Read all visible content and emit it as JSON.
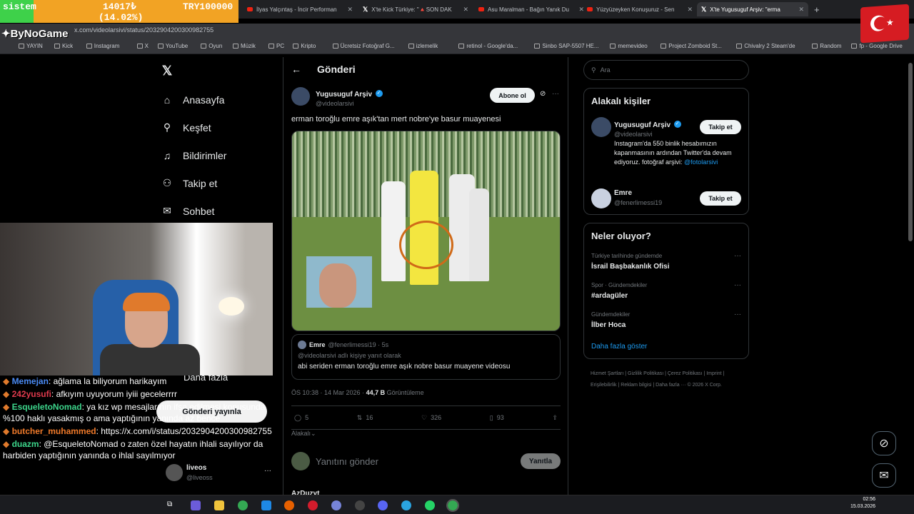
{
  "browser": {
    "tabs": [
      {
        "label": "İlyas Yalçıntaş - İncir Performan",
        "type": "youtube"
      },
      {
        "label": "X'te Kick Türkiye: \"🔺SON DAK",
        "type": "x"
      },
      {
        "label": "Asu Maralman - Bağın Yanık Du",
        "type": "youtube"
      },
      {
        "label": "Yüzyüzeyken Konuşuruz - Sen",
        "type": "youtube"
      },
      {
        "label": "X'te Yugusuguf Arşiv: \"erma",
        "type": "x"
      }
    ],
    "url": "x.com/videolarsivi/status/2032904200300982755",
    "bookmarks": [
      "YAYIN",
      "Kick",
      "Instagram",
      "X",
      "YouTube",
      "Oyun",
      "Müzik",
      "PC",
      "Kripto",
      "Ücretsiz Fotoğraf G...",
      "izlemelik",
      "retinol - Google'da...",
      "Sinbo SAP-5507 HE...",
      "memevideo",
      "Project Zomboid St...",
      "Chivalry 2 Steam'de",
      "Random",
      "fp - Google Drive"
    ]
  },
  "stream_overlay": {
    "goal_label": "sistem",
    "goal_value": "14017₺",
    "goal_pct": "(14.02%)",
    "goal_target": "TRY100000",
    "goal_fraction": 0.1402,
    "channel": "ByNoGame"
  },
  "nav": {
    "items": [
      {
        "label": "Anasayfa",
        "icon": "home-icon"
      },
      {
        "label": "Keşfet",
        "icon": "search-icon"
      },
      {
        "label": "Bildirimler",
        "icon": "bell-icon"
      },
      {
        "label": "Takip et",
        "icon": "add-person-icon"
      },
      {
        "label": "Sohbet",
        "icon": "mail-icon"
      }
    ],
    "more": "Daha fazla"
  },
  "chat": [
    {
      "user": "Memejan",
      "color": "#4a8bf5",
      "msg": ": ağlama la biliyorum harikayım"
    },
    {
      "user": "242yusufi",
      "color": "#e03a4d",
      "msg": ": afkıyım uyuyorum iyiii gecelerrrr"
    },
    {
      "user": "EsqueletoNomad",
      "color": "#3dd68c",
      "msg": ": ya kız wp mesajlarının ifşa edilmesi konusunda %100 haklı yasakmış o ama yaptığının yanında az bence"
    },
    {
      "user": "butcher_muhammed",
      "color": "#f07a2a",
      "msg": ": https://x.com/i/status/2032904200300982755"
    },
    {
      "user": "duazm",
      "color": "#3dd68c",
      "msg": ": @EsqueletoNomad o zaten özel hayatın ihlali sayılıyor da harbiden yaptığının yanında o ihlal sayılmıyor"
    }
  ],
  "post": {
    "header": "Gönderi",
    "author_name": "Yugusuguf Arşiv",
    "author_handle": "@videolarsivi",
    "subscribe": "Abone ol",
    "text": "erman toroğlu emre aşık'tan mert nobre'ye basur muayenesi",
    "quote": {
      "name": "Emre",
      "handle": "@fenerlimessi19 · 5s",
      "reply_to": "@videolarsivi adlı kişiye yanıt olarak",
      "text": "abi seriden erman toroğlu emre aşık nobre basur muayene videosu"
    },
    "time": "ÖS 10:38 · 14 Mar 2026 · ",
    "views": "44,7 B",
    "views_label": " Görüntüleme",
    "stats": {
      "replies": "5",
      "reposts": "16",
      "likes": "326",
      "bookmarks": "93"
    },
    "relevance": "Alakalı",
    "reply_placeholder": "Yanıtını gönder",
    "reply_button": "Yanıtla",
    "post_overlay_button": "Gönderi yayınla",
    "next_author": "AzDuzyt",
    "liveos_name": "liveos",
    "liveos_handle": "@liveoss"
  },
  "sidebar": {
    "search_placeholder": "Ara",
    "related_title": "Alakalı kişiler",
    "people": [
      {
        "name": "Yugusuguf Arşiv",
        "handle": "@videolarsivi",
        "bio": "Instagram'da 550 binlik hesabımızın kapanmasının ardından Twitter'da devam ediyoruz. fotoğraf arşivi: ",
        "bio_link": "@fotolarsivi",
        "follow": "Takip et"
      },
      {
        "name": "Emre",
        "handle": "@fenerlimessi19",
        "follow": "Takip et"
      }
    ],
    "trends_title": "Neler oluyor?",
    "trends": [
      {
        "category": "Türkiye tarihinde gündemde",
        "title": "İsrail Başbakanlık Ofisi"
      },
      {
        "category": "Spor · Gündemdekiler",
        "title": "#ardagüler"
      },
      {
        "category": "Gündemdekiler",
        "title": "İlber Hoca"
      }
    ],
    "show_more": "Daha fazla göster",
    "footer": "Hizmet Şartları | Gizlilik Politikası | Çerez Politikası | Imprint | Erişilebilirlik | Reklam bilgisi | Daha fazla ··· © 2026 X Corp."
  },
  "taskbar": {
    "time": "02:56",
    "date": "15.03.2026"
  }
}
